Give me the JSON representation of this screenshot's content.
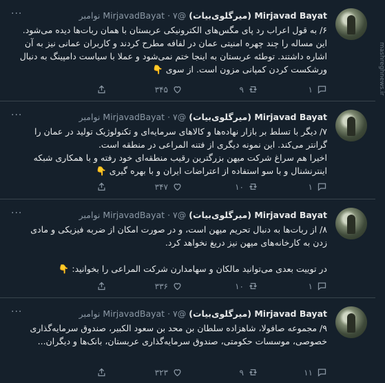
{
  "watermark": "mashreghnews.ir",
  "tweets": [
    {
      "name": "Mirjavad Bayat (میرگلوی‌بیات)",
      "handle": "@MirjavadBayat",
      "date": "۷ نوامبر",
      "text": "۶/ به قول اعراب رد پای مگس‌های الکترونیکی عربستان با همان ربات‌ها دیده می‌شود. این مساله را چند چهره امنیتی عمان در لفافه مطرح کردند و کاربران عمانی نیز به آن اشاره داشتند. توطئه عربستان به اینجا ختم نمی‌شود و عملا با سیاست دامپینگ به دنبال ورشکست کردن کمپانی مزون است. از سوی 👇",
      "replies": "۱",
      "retweets": "۹",
      "likes": "۳۴۵"
    },
    {
      "name": "Mirjavad Bayat (میرگلوی‌بیات)",
      "handle": "@MirjavadBayat",
      "date": "۷ نوامبر",
      "text": "۷/ دیگر با تسلط بر بازار نهاده‌ها و کالاهای سرمایه‌ای و تکنولوژیک تولید در عمان را گرانتر می‌کند. این نمونه دیگری از فتنه المراعی در منطقه است.\nاخیرا هم سراغ شرکت میهن بزرگترین رقیب منطقه‌ای خود رفته و با همکاری شبکه اینترنشنال و با سو استفاده از اعتراضات ایران و با بهره گیری 👇",
      "replies": "۱",
      "retweets": "۱۰",
      "likes": "۳۴۷"
    },
    {
      "name": "Mirjavad Bayat (میرگلوی‌بیات)",
      "handle": "@MirjavadBayat",
      "date": "۷ نوامبر",
      "text": "۸/ از ربات‌ها به دنبال تحریم میهن است، و در صورت امکان از ضربه فیزیکی و مادی زدن به کارخانه‌های میهن نیز دریغ نخواهد کرد.\n\nدر توییت بعدی می‌توانید مالکان و سهامدارن شرکت المراعی را بخوانید: 👇",
      "replies": "۱",
      "retweets": "۱۰",
      "likes": "۳۳۶"
    },
    {
      "name": "Mirjavad Bayat (میرگلوی‌بیات)",
      "handle": "@MirjavadBayat",
      "date": "۷ نوامبر",
      "text": "۹/ مجموعه صافولا، شاهزاده سلطان بن محد بن سعود الکبیر، صندوق سرمایه‌گذاری خصوصی، موسسات حکومتی، صندوق سرمایه‌گذاری عربستان، بانک‌ها و دیگران...",
      "replies": "۱۱",
      "retweets": "۹",
      "likes": "۳۲۳"
    }
  ]
}
